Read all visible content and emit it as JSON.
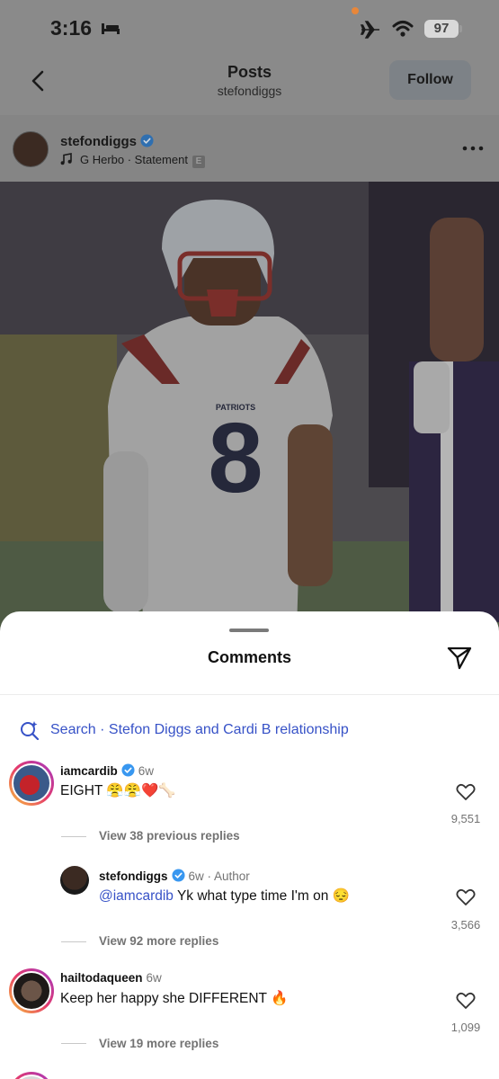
{
  "status_bar": {
    "time": "3:16",
    "battery": "97",
    "icons": [
      "bed-icon",
      "airplane-icon",
      "wifi-icon",
      "battery-icon"
    ],
    "dot_color": "#e8873a"
  },
  "nav": {
    "title": "Posts",
    "subtitle": "stefondiggs",
    "follow_label": "Follow"
  },
  "post": {
    "username": "stefondiggs",
    "audio": "G Herbo · Statement",
    "explicit_badge": "E"
  },
  "sheet": {
    "title": "Comments",
    "search_text": "Search · Stefon Diggs and Cardi B relationship"
  },
  "comments": [
    {
      "username": "iamcardib",
      "meta": "6w",
      "text": "EIGHT 😤😤❤️🦴",
      "likes": "9,551",
      "view_replies": "View 38 previous replies"
    },
    {
      "username": "stefondiggs",
      "meta": "6w · Author",
      "mention": "@iamcardib",
      "text": " Yk what type time I'm on 😔",
      "likes": "3,566",
      "view_replies": "View 92 more replies"
    },
    {
      "username": "hailtodaqueen",
      "meta": "6w",
      "text": "Keep her happy she DIFFERENT 🔥",
      "likes": "1,099",
      "view_replies": "View 19 more replies"
    }
  ],
  "colors": {
    "link_blue": "#3752c7",
    "verified_blue": "#3897f0",
    "muted_gray": "#737373"
  }
}
